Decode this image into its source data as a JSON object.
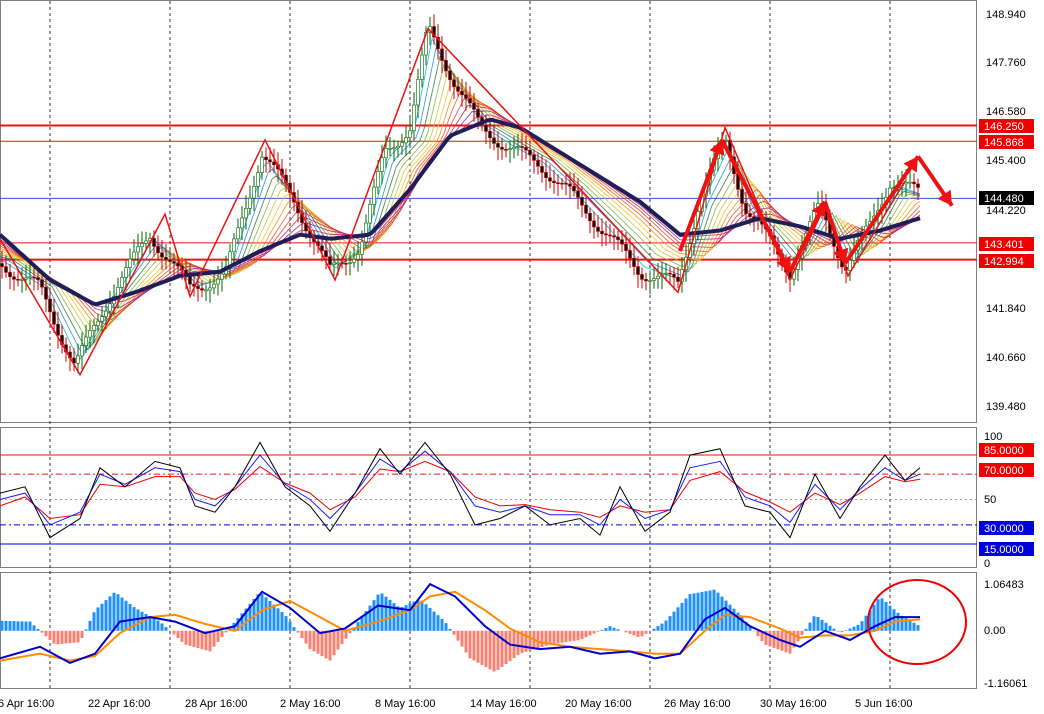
{
  "colors": {
    "background": "#ffffff",
    "border": "#808080",
    "grid": "#000000",
    "level_red": "#ee1111",
    "level_blue": "#3355dd",
    "bull_candle": "#006600",
    "bear_candle": "#cc0000",
    "ma_main": "#1e1e5a",
    "stoch_black": "#000000",
    "stoch_blue": "#1a1aff",
    "stoch_red": "#ee0000",
    "hist_pos": "#1e90ff",
    "hist_neg": "#fa8072",
    "macd_line": "#0000cc",
    "signal_line": "#ff8c00",
    "tag_red": "#ee0000",
    "tag_blue": "#0000dd",
    "tag_black": "#000000",
    "ellipse": "#ee0000"
  },
  "price_axis": {
    "labels": [
      "148.940",
      "147.760",
      "146.580",
      "145.400",
      "144.220",
      "141.840",
      "140.660",
      "139.480"
    ],
    "min": 139.1,
    "max": 149.2
  },
  "price_tags": {
    "resistance_top": "146.250",
    "resistance_2": "145.868",
    "current": "144.480",
    "support_1": "143.401",
    "support_2": "142.994"
  },
  "stoch_axis": {
    "labels": [
      "100",
      "50",
      "0"
    ],
    "level_tags": [
      "85.0000",
      "70.0000",
      "30.0000",
      "15.0000"
    ]
  },
  "macd_axis": {
    "labels": [
      "1.06483",
      "0.00",
      "-1.16061"
    ]
  },
  "time_axis": {
    "labels": [
      "6 Apr 16:00",
      "22 Apr 16:00",
      "28 Apr 16:00",
      "2 May 16:00",
      "8 May 16:00",
      "14 May 16:00",
      "20 May 16:00",
      "26 May 16:00",
      "30 May 16:00",
      "5 Jun 16:00"
    ]
  },
  "chart_data": {
    "type": "line",
    "main": {
      "close_path": [
        [
          0,
          142.9
        ],
        [
          40,
          142.3
        ],
        [
          75,
          140.4
        ],
        [
          110,
          142.1
        ],
        [
          150,
          143.6
        ],
        [
          190,
          142.3
        ],
        [
          225,
          142.6
        ],
        [
          262,
          145.6
        ],
        [
          295,
          144.4
        ],
        [
          330,
          142.7
        ],
        [
          360,
          143.3
        ],
        [
          385,
          145.6
        ],
        [
          410,
          146.2
        ],
        [
          428,
          148.6
        ],
        [
          455,
          147.3
        ],
        [
          480,
          146.2
        ],
        [
          510,
          145.7
        ],
        [
          540,
          145.3
        ],
        [
          570,
          144.6
        ],
        [
          600,
          143.8
        ],
        [
          640,
          142.7
        ],
        [
          678,
          142.4
        ],
        [
          700,
          144.5
        ],
        [
          725,
          145.9
        ],
        [
          745,
          144.3
        ],
        [
          790,
          142.7
        ],
        [
          820,
          144.3
        ],
        [
          845,
          142.8
        ],
        [
          870,
          143.8
        ],
        [
          890,
          144.9
        ],
        [
          920,
          144.6
        ]
      ],
      "ma_path": [
        [
          0,
          143.6
        ],
        [
          50,
          142.5
        ],
        [
          95,
          141.9
        ],
        [
          135,
          142.2
        ],
        [
          180,
          142.6
        ],
        [
          220,
          142.7
        ],
        [
          260,
          143.2
        ],
        [
          300,
          143.6
        ],
        [
          330,
          143.5
        ],
        [
          370,
          143.6
        ],
        [
          410,
          144.7
        ],
        [
          450,
          146.0
        ],
        [
          490,
          146.4
        ],
        [
          520,
          146.2
        ],
        [
          560,
          145.6
        ],
        [
          600,
          145.0
        ],
        [
          640,
          144.4
        ],
        [
          680,
          143.6
        ],
        [
          720,
          143.7
        ],
        [
          760,
          144.0
        ],
        [
          800,
          143.8
        ],
        [
          840,
          143.5
        ],
        [
          880,
          143.7
        ],
        [
          920,
          144.0
        ]
      ],
      "zigzag": [
        [
          0,
          143.5
        ],
        [
          80,
          140.2
        ],
        [
          165,
          144.1
        ],
        [
          190,
          142.1
        ],
        [
          265,
          145.9
        ],
        [
          335,
          142.5
        ],
        [
          428,
          148.6
        ],
        [
          678,
          142.2
        ],
        [
          725,
          146.2
        ],
        [
          790,
          142.5
        ],
        [
          825,
          144.3
        ],
        [
          848,
          142.6
        ],
        [
          905,
          144.9
        ]
      ],
      "red_arrows": [
        [
          [
            680,
            143.2
          ],
          [
            722,
            145.9
          ]
        ],
        [
          [
            722,
            145.9
          ],
          [
            790,
            142.7
          ]
        ],
        [
          [
            790,
            142.7
          ],
          [
            825,
            144.4
          ]
        ],
        [
          [
            825,
            144.4
          ],
          [
            845,
            142.9
          ]
        ],
        [
          [
            845,
            142.9
          ],
          [
            918,
            145.5
          ]
        ],
        [
          [
            918,
            145.5
          ],
          [
            952,
            144.3
          ]
        ]
      ],
      "hlines": {
        "resistance_top": 146.25,
        "resistance_2": 145.868,
        "current": 144.48,
        "support_1": 143.401,
        "support_2": 142.994
      },
      "vlines_x": [
        50,
        170,
        290,
        410,
        530,
        650,
        770,
        890
      ]
    },
    "stochastic": {
      "min": 0,
      "max": 100,
      "levels": [
        85,
        70,
        30,
        15
      ],
      "black": [
        [
          0,
          55
        ],
        [
          25,
          60
        ],
        [
          50,
          20
        ],
        [
          80,
          35
        ],
        [
          100,
          75
        ],
        [
          125,
          60
        ],
        [
          155,
          80
        ],
        [
          180,
          75
        ],
        [
          195,
          45
        ],
        [
          215,
          40
        ],
        [
          235,
          60
        ],
        [
          260,
          95
        ],
        [
          285,
          60
        ],
        [
          310,
          45
        ],
        [
          330,
          25
        ],
        [
          355,
          55
        ],
        [
          380,
          90
        ],
        [
          400,
          70
        ],
        [
          425,
          95
        ],
        [
          450,
          70
        ],
        [
          475,
          30
        ],
        [
          500,
          35
        ],
        [
          525,
          45
        ],
        [
          550,
          30
        ],
        [
          580,
          35
        ],
        [
          600,
          22
        ],
        [
          620,
          60
        ],
        [
          645,
          25
        ],
        [
          670,
          40
        ],
        [
          690,
          85
        ],
        [
          720,
          90
        ],
        [
          745,
          45
        ],
        [
          770,
          40
        ],
        [
          790,
          20
        ],
        [
          815,
          70
        ],
        [
          840,
          35
        ],
        [
          860,
          60
        ],
        [
          885,
          85
        ],
        [
          905,
          65
        ],
        [
          920,
          75
        ]
      ],
      "blue": [
        [
          0,
          50
        ],
        [
          25,
          55
        ],
        [
          50,
          30
        ],
        [
          80,
          40
        ],
        [
          100,
          70
        ],
        [
          125,
          62
        ],
        [
          155,
          75
        ],
        [
          180,
          72
        ],
        [
          195,
          50
        ],
        [
          215,
          45
        ],
        [
          235,
          60
        ],
        [
          260,
          85
        ],
        [
          285,
          62
        ],
        [
          310,
          50
        ],
        [
          330,
          35
        ],
        [
          355,
          55
        ],
        [
          380,
          82
        ],
        [
          400,
          72
        ],
        [
          425,
          88
        ],
        [
          450,
          72
        ],
        [
          475,
          45
        ],
        [
          500,
          40
        ],
        [
          525,
          45
        ],
        [
          550,
          38
        ],
        [
          580,
          38
        ],
        [
          600,
          30
        ],
        [
          620,
          50
        ],
        [
          645,
          35
        ],
        [
          670,
          42
        ],
        [
          690,
          75
        ],
        [
          720,
          80
        ],
        [
          745,
          52
        ],
        [
          770,
          45
        ],
        [
          790,
          32
        ],
        [
          815,
          62
        ],
        [
          840,
          42
        ],
        [
          860,
          58
        ],
        [
          885,
          75
        ],
        [
          905,
          65
        ],
        [
          920,
          70
        ]
      ],
      "red": [
        [
          0,
          45
        ],
        [
          25,
          52
        ],
        [
          50,
          35
        ],
        [
          80,
          38
        ],
        [
          100,
          62
        ],
        [
          125,
          60
        ],
        [
          155,
          68
        ],
        [
          180,
          68
        ],
        [
          195,
          55
        ],
        [
          215,
          50
        ],
        [
          235,
          58
        ],
        [
          260,
          76
        ],
        [
          285,
          63
        ],
        [
          310,
          55
        ],
        [
          330,
          42
        ],
        [
          355,
          52
        ],
        [
          380,
          74
        ],
        [
          400,
          72
        ],
        [
          425,
          80
        ],
        [
          450,
          72
        ],
        [
          475,
          52
        ],
        [
          500,
          45
        ],
        [
          525,
          46
        ],
        [
          550,
          42
        ],
        [
          580,
          40
        ],
        [
          600,
          36
        ],
        [
          620,
          45
        ],
        [
          645,
          40
        ],
        [
          670,
          42
        ],
        [
          690,
          65
        ],
        [
          720,
          72
        ],
        [
          745,
          56
        ],
        [
          770,
          48
        ],
        [
          790,
          40
        ],
        [
          815,
          55
        ],
        [
          840,
          46
        ],
        [
          860,
          55
        ],
        [
          885,
          68
        ],
        [
          905,
          64
        ],
        [
          920,
          66
        ]
      ]
    },
    "macd": {
      "min": -1.16061,
      "max": 1.06483,
      "histogram": [
        [
          0,
          0.22
        ],
        [
          30,
          0.2
        ],
        [
          55,
          -0.3
        ],
        [
          80,
          -0.25
        ],
        [
          95,
          0.45
        ],
        [
          115,
          0.85
        ],
        [
          135,
          0.5
        ],
        [
          160,
          0.2
        ],
        [
          185,
          -0.3
        ],
        [
          210,
          -0.45
        ],
        [
          235,
          0.2
        ],
        [
          260,
          0.85
        ],
        [
          285,
          0.35
        ],
        [
          310,
          -0.4
        ],
        [
          330,
          -0.65
        ],
        [
          355,
          0.1
        ],
        [
          380,
          0.85
        ],
        [
          400,
          0.5
        ],
        [
          420,
          0.7
        ],
        [
          445,
          0.2
        ],
        [
          470,
          -0.6
        ],
        [
          495,
          -0.9
        ],
        [
          520,
          -0.5
        ],
        [
          550,
          -0.3
        ],
        [
          580,
          -0.2
        ],
        [
          610,
          0.1
        ],
        [
          640,
          -0.15
        ],
        [
          665,
          0.2
        ],
        [
          690,
          0.8
        ],
        [
          715,
          0.9
        ],
        [
          740,
          0.35
        ],
        [
          765,
          -0.3
        ],
        [
          790,
          -0.5
        ],
        [
          815,
          0.35
        ],
        [
          840,
          -0.05
        ],
        [
          860,
          0.15
        ],
        [
          880,
          0.75
        ],
        [
          900,
          0.35
        ],
        [
          920,
          0.1
        ]
      ],
      "macd": [
        [
          0,
          -0.6
        ],
        [
          40,
          -0.35
        ],
        [
          70,
          -0.7
        ],
        [
          95,
          -0.5
        ],
        [
          120,
          0.2
        ],
        [
          150,
          0.3
        ],
        [
          175,
          0.2
        ],
        [
          205,
          -0.05
        ],
        [
          235,
          0.1
        ],
        [
          262,
          0.85
        ],
        [
          290,
          0.5
        ],
        [
          320,
          -0.05
        ],
        [
          345,
          0.05
        ],
        [
          378,
          0.55
        ],
        [
          410,
          0.45
        ],
        [
          430,
          1.02
        ],
        [
          455,
          0.75
        ],
        [
          485,
          0.1
        ],
        [
          510,
          -0.3
        ],
        [
          540,
          -0.4
        ],
        [
          570,
          -0.35
        ],
        [
          600,
          -0.5
        ],
        [
          630,
          -0.45
        ],
        [
          655,
          -0.6
        ],
        [
          680,
          -0.5
        ],
        [
          705,
          0.25
        ],
        [
          725,
          0.5
        ],
        [
          750,
          0.1
        ],
        [
          780,
          -0.2
        ],
        [
          800,
          -0.35
        ],
        [
          825,
          0.0
        ],
        [
          850,
          -0.2
        ],
        [
          875,
          0.1
        ],
        [
          895,
          0.3
        ],
        [
          920,
          0.3
        ]
      ],
      "signal": [
        [
          0,
          -0.65
        ],
        [
          40,
          -0.5
        ],
        [
          70,
          -0.65
        ],
        [
          95,
          -0.55
        ],
        [
          120,
          -0.05
        ],
        [
          150,
          0.3
        ],
        [
          175,
          0.35
        ],
        [
          205,
          0.15
        ],
        [
          235,
          0.0
        ],
        [
          262,
          0.45
        ],
        [
          290,
          0.65
        ],
        [
          320,
          0.3
        ],
        [
          345,
          0.0
        ],
        [
          378,
          0.2
        ],
        [
          410,
          0.45
        ],
        [
          430,
          0.75
        ],
        [
          455,
          0.85
        ],
        [
          485,
          0.45
        ],
        [
          510,
          0.05
        ],
        [
          540,
          -0.25
        ],
        [
          570,
          -0.35
        ],
        [
          600,
          -0.4
        ],
        [
          630,
          -0.45
        ],
        [
          655,
          -0.5
        ],
        [
          680,
          -0.5
        ],
        [
          705,
          0.0
        ],
        [
          725,
          0.35
        ],
        [
          750,
          0.3
        ],
        [
          780,
          0.05
        ],
        [
          800,
          -0.15
        ],
        [
          825,
          -0.1
        ],
        [
          850,
          -0.1
        ],
        [
          875,
          0.0
        ],
        [
          895,
          0.2
        ],
        [
          920,
          0.25
        ]
      ]
    }
  }
}
